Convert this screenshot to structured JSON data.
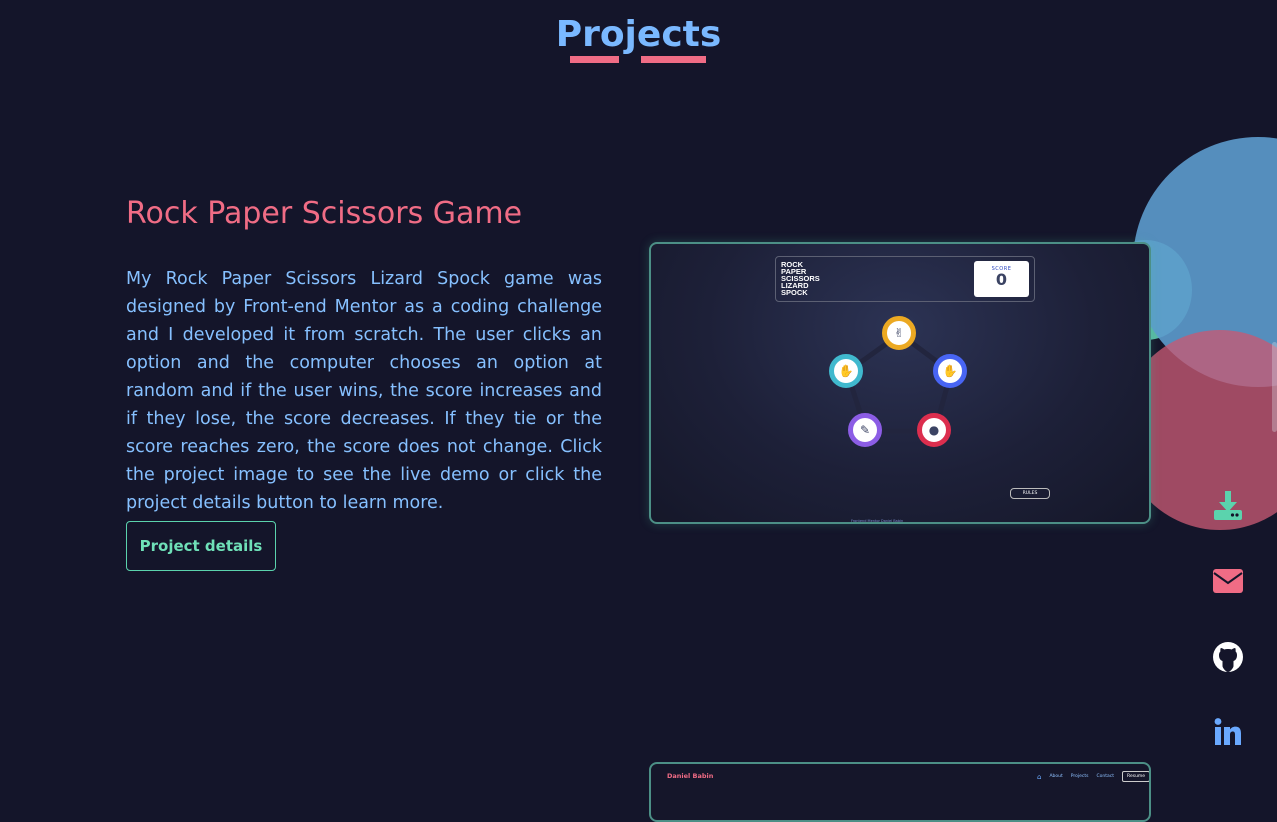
{
  "section": {
    "title": "Projects"
  },
  "project": {
    "title": "Rock Paper Scissors Game",
    "description": "My Rock Paper Scissors Lizard Spock game was designed by Front-end Mentor as a coding challenge and I developed it from scratch. The user clicks an option and the computer chooses an option at random and if the user wins, the score increases and if they lose, the score decreases. If they tie or the score reaches zero, the score does not change. Click the project image to see the live demo or click the project details button to learn more.",
    "details_label": "Project details"
  },
  "screenshot": {
    "logo_text": "ROCK\nPAPER\nSCISSORS\nLIZARD\nSPOCK",
    "score_label": "SCORE",
    "score_value": "0",
    "rules_label": "RULES",
    "attribution": "Frontend Mentor   Daniel Babin",
    "tokens": [
      {
        "name": "scissors",
        "color": "#eca922",
        "icon": "scissors-icon"
      },
      {
        "name": "paper",
        "color": "#4865f4",
        "icon": "paper-icon"
      },
      {
        "name": "rock",
        "color": "#dc2e4e",
        "icon": "rock-icon"
      },
      {
        "name": "lizard",
        "color": "#8c5de5",
        "icon": "lizard-icon"
      },
      {
        "name": "spock",
        "color": "#40b9ce",
        "icon": "spock-icon"
      }
    ]
  },
  "screenshot2": {
    "brand": "Daniel Babin",
    "nav": [
      "About",
      "Projects",
      "Contact"
    ],
    "resume_label": "Resume"
  },
  "social": [
    {
      "icon": "download-icon",
      "color": "#5bd3ad"
    },
    {
      "icon": "email-icon",
      "color": "#f06c85"
    },
    {
      "icon": "github-icon",
      "color": "#ffffff"
    },
    {
      "icon": "linkedin-icon",
      "color": "#6aa9ff"
    }
  ],
  "colors": {
    "background": "#14152a",
    "accent_pink": "#f06c85",
    "accent_blue": "#7ab8ff",
    "accent_green": "#5bd3ad"
  }
}
